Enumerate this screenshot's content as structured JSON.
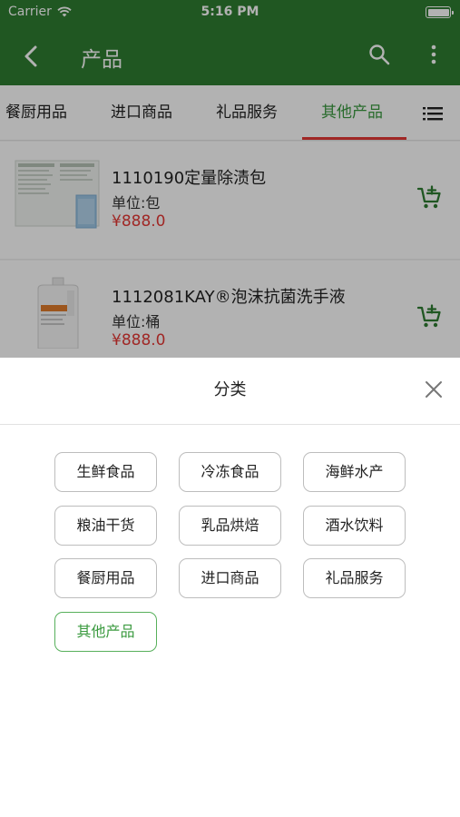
{
  "status_bar": {
    "carrier": "Carrier",
    "time": "5:16 PM"
  },
  "nav": {
    "title": "产品"
  },
  "tabs": [
    {
      "label": "餐厨用品"
    },
    {
      "label": "进口商品"
    },
    {
      "label": "礼品服务"
    },
    {
      "label": "其他产品",
      "active": true
    }
  ],
  "products": [
    {
      "name": "1110190定量除渍包",
      "unit": "单位:包",
      "price": "¥888.0"
    },
    {
      "name": "1112081KAY®泡沫抗菌洗手液",
      "unit": "单位:桶",
      "price": "¥888.0"
    }
  ],
  "category_sheet": {
    "title": "分类",
    "categories": [
      {
        "label": "生鲜食品"
      },
      {
        "label": "冷冻食品"
      },
      {
        "label": "海鲜水产"
      },
      {
        "label": "粮油干货"
      },
      {
        "label": "乳品烘焙"
      },
      {
        "label": "酒水饮料"
      },
      {
        "label": "餐厨用品"
      },
      {
        "label": "进口商品"
      },
      {
        "label": "礼品服务"
      },
      {
        "label": "其他产品",
        "selected": true
      }
    ]
  },
  "colors": {
    "brand_green": "#2e7d32",
    "active_green": "#3a9a3f",
    "price_red": "#e53935",
    "tab_indicator": "#e53935"
  },
  "icons": [
    "wifi-icon",
    "battery-icon",
    "back-arrow-icon",
    "search-icon",
    "more-vertical-icon",
    "list-menu-icon",
    "add-to-cart-icon",
    "close-icon"
  ]
}
